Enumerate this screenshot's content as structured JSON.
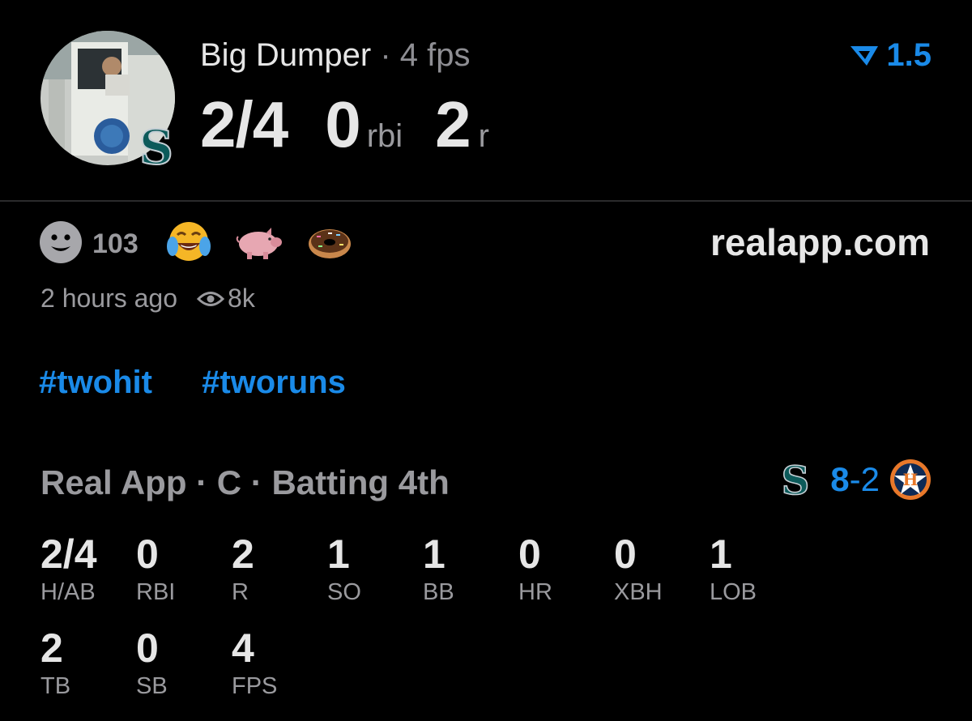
{
  "header": {
    "player_name": "Big Dumper",
    "separator": " · ",
    "fps": "4 fps",
    "hits_ab": "2/4",
    "rbi_value": "0",
    "rbi_label": "rbi",
    "runs_value": "2",
    "runs_label": "r",
    "rating": "1.5"
  },
  "reactions": {
    "count": "103",
    "items": [
      "laughing-tears-emoji",
      "pig-emoji",
      "donut-emoji"
    ]
  },
  "site": "realapp.com",
  "meta": {
    "time": "2 hours ago",
    "views": "8k"
  },
  "tags": [
    "#twohit",
    "#tworuns"
  ],
  "game": {
    "line": "Real App · C · Batting 4th",
    "home_score": "8",
    "dash": "-",
    "away_score": "2"
  },
  "stats_row1": [
    {
      "value": "2/4",
      "label": "H/AB"
    },
    {
      "value": "0",
      "label": "RBI"
    },
    {
      "value": "2",
      "label": "R"
    },
    {
      "value": "1",
      "label": "SO"
    },
    {
      "value": "1",
      "label": "BB"
    },
    {
      "value": "0",
      "label": "HR"
    },
    {
      "value": "0",
      "label": "XBH"
    },
    {
      "value": "1",
      "label": "LOB"
    }
  ],
  "stats_row2": [
    {
      "value": "2",
      "label": "TB"
    },
    {
      "value": "0",
      "label": "SB"
    },
    {
      "value": "4",
      "label": "FPS"
    }
  ],
  "colors": {
    "accent": "#1a8ae8",
    "background": "#000000",
    "muted": "#9a9a9e"
  }
}
